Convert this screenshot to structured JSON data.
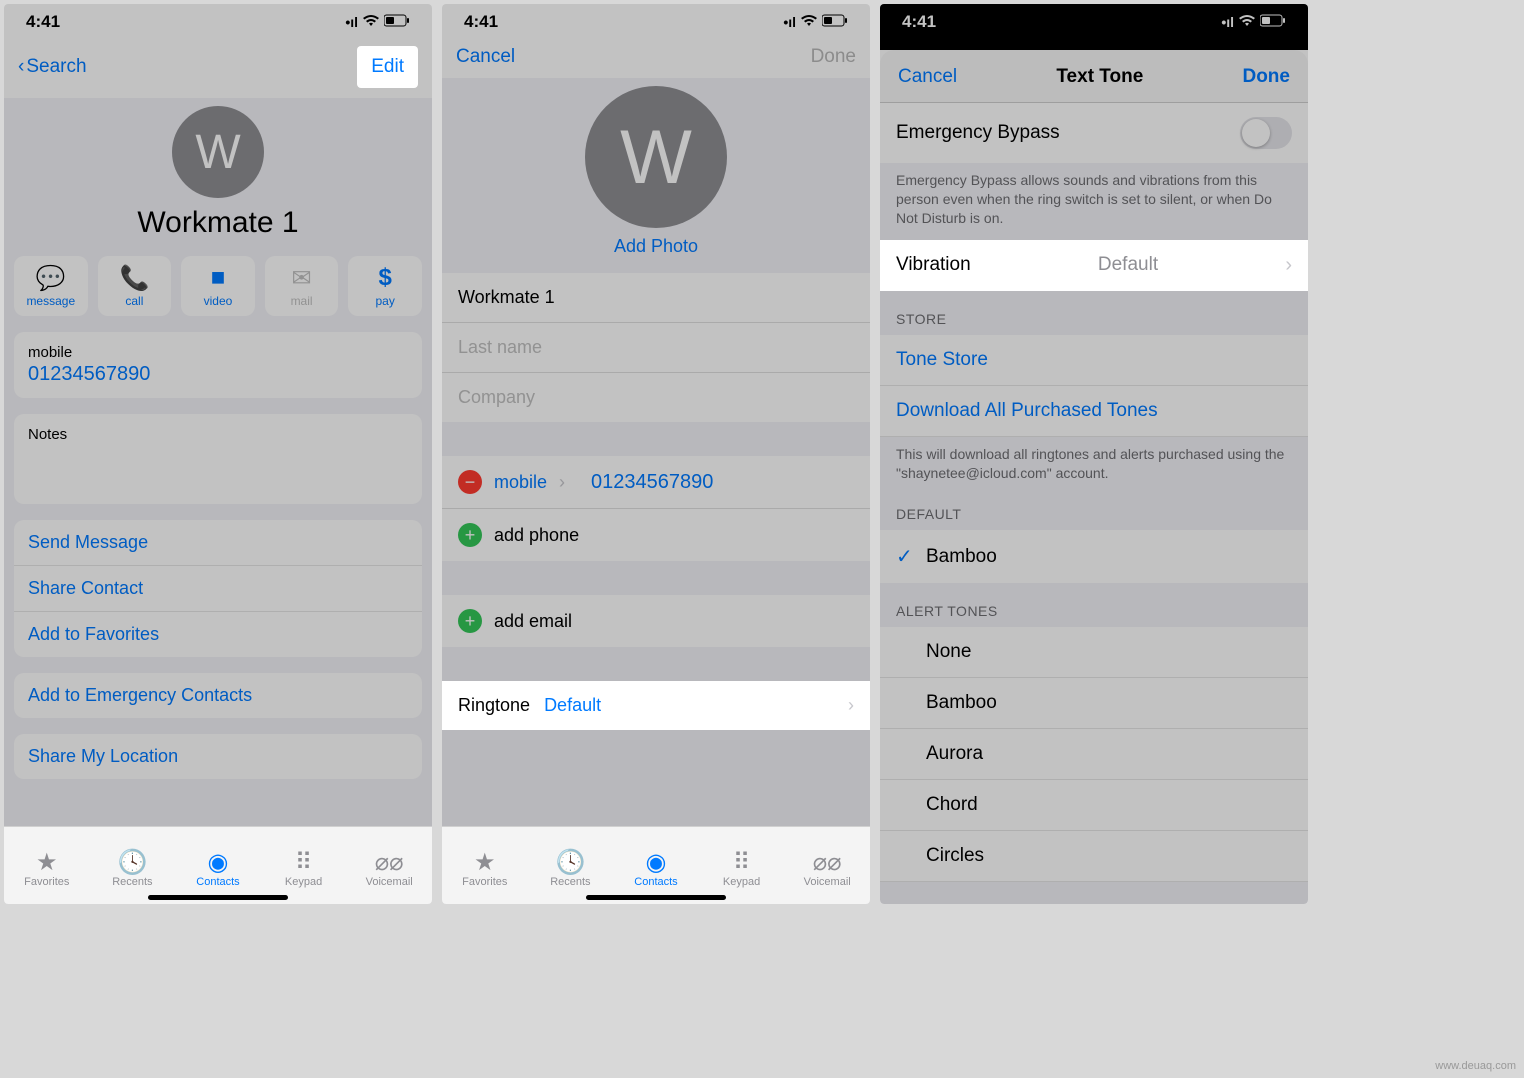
{
  "status": {
    "time": "4:41"
  },
  "screen1": {
    "back": "Search",
    "edit": "Edit",
    "avatar_initial": "W",
    "name": "Workmate 1",
    "actions": {
      "message": "message",
      "call": "call",
      "video": "video",
      "mail": "mail",
      "pay": "pay"
    },
    "phone_label": "mobile",
    "phone_value": "01234567890",
    "notes_label": "Notes",
    "links": {
      "send_message": "Send Message",
      "share_contact": "Share Contact",
      "add_favorites": "Add to Favorites",
      "add_emergency": "Add to Emergency Contacts",
      "share_location": "Share My Location"
    }
  },
  "screen2": {
    "cancel": "Cancel",
    "done": "Done",
    "avatar_initial": "W",
    "add_photo": "Add Photo",
    "first_name": "Workmate 1",
    "last_name_ph": "Last name",
    "company_ph": "Company",
    "mobile_label": "mobile",
    "mobile_value": "01234567890",
    "add_phone": "add phone",
    "add_email": "add email",
    "ringtone_label": "Ringtone",
    "ringtone_value": "Default"
  },
  "screen3": {
    "cancel": "Cancel",
    "title": "Text Tone",
    "done": "Done",
    "emergency_bypass": "Emergency Bypass",
    "emergency_desc": "Emergency Bypass allows sounds and vibrations from this person even when the ring switch is set to silent, or when Do Not Disturb is on.",
    "vibration_label": "Vibration",
    "vibration_value": "Default",
    "store_header": "STORE",
    "tone_store": "Tone Store",
    "download_all": "Download All Purchased Tones",
    "download_desc": "This will download all ringtones and alerts purchased using the \"shaynetee@icloud.com\" account.",
    "default_header": "DEFAULT",
    "default_selected": "Bamboo",
    "alert_header": "ALERT TONES",
    "tones": {
      "t0": "None",
      "t1": "Bamboo",
      "t2": "Aurora",
      "t3": "Chord",
      "t4": "Circles"
    }
  },
  "tabs": {
    "favorites": "Favorites",
    "recents": "Recents",
    "contacts": "Contacts",
    "keypad": "Keypad",
    "voicemail": "Voicemail"
  },
  "watermark": "www.deuaq.com"
}
